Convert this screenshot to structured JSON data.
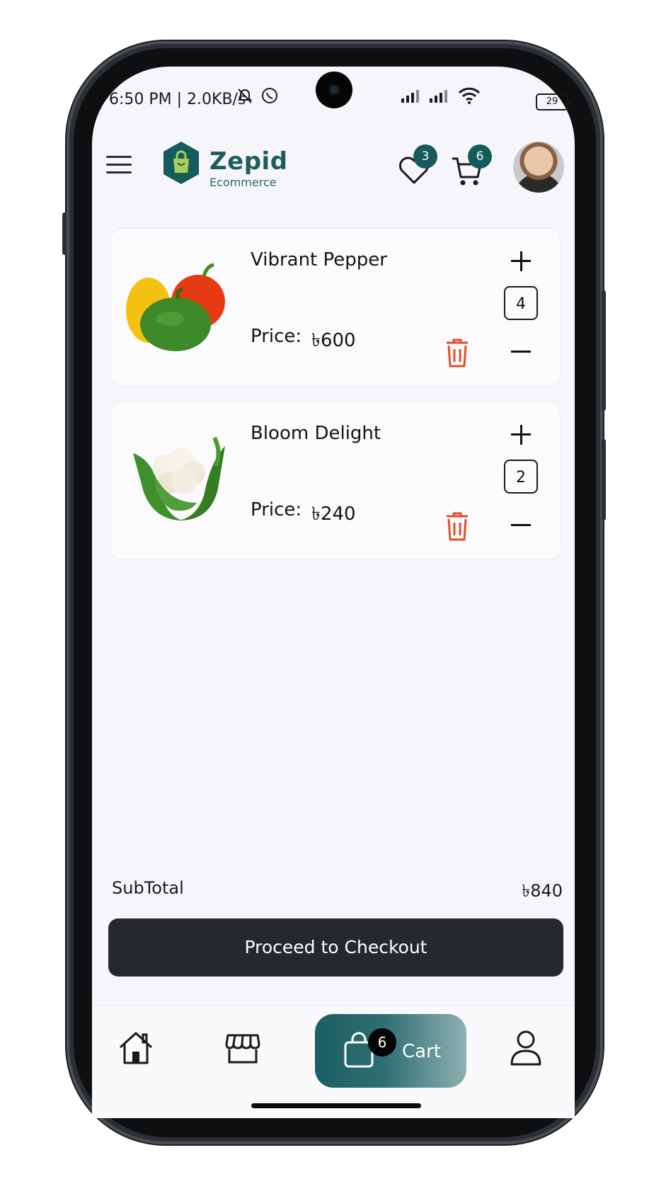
{
  "status_bar": {
    "time_speed": "6:50 PM | 2.0KB/s",
    "battery": "29"
  },
  "header": {
    "brand_name": "Zepid",
    "brand_sub": "Ecommerce",
    "wishlist_count": "3",
    "cart_count": "6"
  },
  "cart": {
    "items": [
      {
        "name": "Vibrant Pepper",
        "price_label": "Price:",
        "price": "৳600",
        "quantity": "4",
        "image": "bell-peppers"
      },
      {
        "name": "Bloom Delight",
        "price_label": "Price:",
        "price": "৳240",
        "quantity": "2",
        "image": "cauliflower"
      }
    ],
    "subtotal_label": "SubTotal",
    "subtotal_value": "৳840",
    "checkout_label": "Proceed to Checkout"
  },
  "bottom_nav": {
    "items": [
      {
        "icon": "home-icon"
      },
      {
        "icon": "store-icon"
      },
      {
        "icon": "shopping-bag-icon",
        "label": "Cart",
        "badge": "6",
        "active": true
      },
      {
        "icon": "user-icon"
      }
    ]
  },
  "colors": {
    "brand": "#175a5c",
    "delete": "#e0502a",
    "checkout_bg": "#25282d"
  }
}
